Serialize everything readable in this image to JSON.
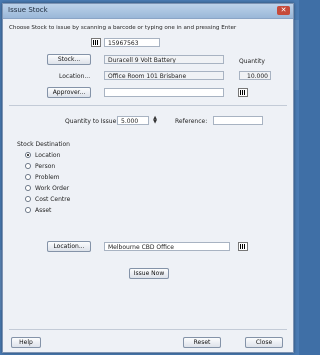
{
  "window": {
    "title": "Issue Stock"
  },
  "instructions": "Choose Stock to issue by scanning a barcode or typing one in and pressing Enter",
  "barcode_value": "15967563",
  "stock": {
    "button_label": "Stock...",
    "value": "Duracell 9 Volt Battery"
  },
  "quantity": {
    "label": "Quantity",
    "value": "10.000"
  },
  "location": {
    "label": "Location...",
    "value": "Office Room 101 Brisbane"
  },
  "approver": {
    "button_label": "Approver...",
    "value": ""
  },
  "quantity_to_issue": {
    "label": "Quantity to Issue:",
    "value": "5.000"
  },
  "reference": {
    "label": "Reference:",
    "value": ""
  },
  "stock_destination": {
    "label": "Stock Destination",
    "options": [
      "Location",
      "Person",
      "Problem",
      "Work Order",
      "Cost Centre",
      "Asset"
    ],
    "selected": "Location"
  },
  "destination_location": {
    "button_label": "Location...",
    "value": "Melbourne CBD Office"
  },
  "issue_now_label": "Issue Now",
  "footer": {
    "help_label": "Help",
    "reset_label": "Reset",
    "close_label": "Close"
  }
}
